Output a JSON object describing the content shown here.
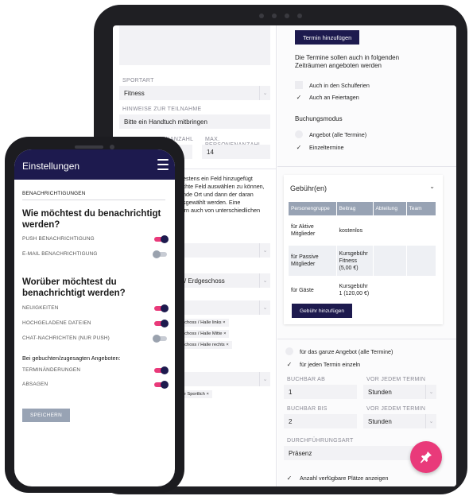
{
  "tablet": {
    "left": {
      "sportart_label": "SPORTART",
      "sportart_value": "Fitness",
      "hinweise_label": "HINWEISE ZUR TEILNAHME",
      "hinweise_value": "Bitte ein Handtuch mitbringen",
      "min_label": "MIN. PERSONENANZAHL",
      "max_label": "MAX. PERSONENANZAHL",
      "max_value": "14",
      "info_lines": [
        "ndestens ein Feld hinzugefügt",
        "aschte Feld auswählen zu können,",
        "hende Ort und dann der daran",
        "ausgewählt werden. Eine",
        "ldern auch von unterschiedlichen"
      ],
      "ort_value": "/ Erdgeschoss",
      "chips": [
        "eschoss / Halle links",
        "eschoss / Halle Mitte",
        "eschoss / Halle rechts"
      ],
      "chip_extra": "nie Sportlich"
    },
    "right": {
      "add_term_btn": "Termin hinzufügen",
      "intro_line1": "Die Termine sollen auch in folgenden",
      "intro_line2": "Zeiträumen angeboten werden",
      "schulferien": "Auch in den Schulferien",
      "feiertage": "Auch an Feiertagen",
      "buchungsmodus": "Buchungsmodus",
      "angebot": "Angebot (alle Termine)",
      "einzeltermine": "Einzeltermine",
      "fee_title": "Gebühr(en)",
      "fee_headers": [
        "Personengruppe",
        "Beitrag",
        "Abteilung",
        "Team"
      ],
      "fee_rows": [
        {
          "gruppe": "für Aktive Mitglieder",
          "beitrag": "kostenlos"
        },
        {
          "gruppe": "für Passive Mitglieder",
          "beitrag": "Kursgebühr Fitness (5,00 €)"
        },
        {
          "gruppe": "für Gäste",
          "beitrag": "Kursgebühr 1 (120,00 €)"
        }
      ],
      "add_fee_btn": "Gebühr hinzufügen",
      "ganze_angebot": "für das ganze Angebot (alle Termine)",
      "jeden_termin": "für jeden Termin einzeln",
      "buchbar_ab_label": "BUCHBAR AB",
      "buchbar_ab_value": "1",
      "vor_label_1": "VOR JEDEM TERMIN",
      "vor_value_1": "Stunden",
      "buchbar_bis_label": "BUCHBAR BIS",
      "buchbar_bis_value": "2",
      "vor_label_2": "VOR JEDEM TERMIN",
      "vor_value_2": "Stunden",
      "durchfuehrung_label": "DURCHFÜHRUNGSART",
      "durchfuehrung_value": "Präsenz",
      "plaetze": "Anzahl verfügbare Plätze anzeigen"
    }
  },
  "phone": {
    "title": "Einstellungen",
    "section": "BENACHRICHTIGUNGEN",
    "q1": "Wie möchtest du benachrichtigt werden?",
    "push": "PUSH BENACHRICHTIGUNG",
    "email": "E-MAIL BENACHRICHTIGUNG",
    "q2": "Worüber möchtest du benachrichtigt werden?",
    "neuigkeiten": "NEUIGKEITEN",
    "dateien": "HOCHGELADENE DATEIEN",
    "chat": "CHAT-NACHRICHTEN (NUR PUSH)",
    "sub": "Bei gebuchten/zugesagten Angeboten:",
    "aenderungen": "TERMINÄNDERUNGEN",
    "absagen": "ABSAGEN",
    "save": "SPEICHERN",
    "toggles": {
      "push": true,
      "email": false,
      "neuigkeiten": true,
      "dateien": true,
      "chat": false,
      "aenderungen": true,
      "absagen": true
    }
  },
  "colors": {
    "primary": "#1d1a4e",
    "accent": "#e93a7a",
    "muted": "#98a3b4"
  },
  "icons": {
    "fab": "pin-icon",
    "menu": "hamburger-icon"
  }
}
